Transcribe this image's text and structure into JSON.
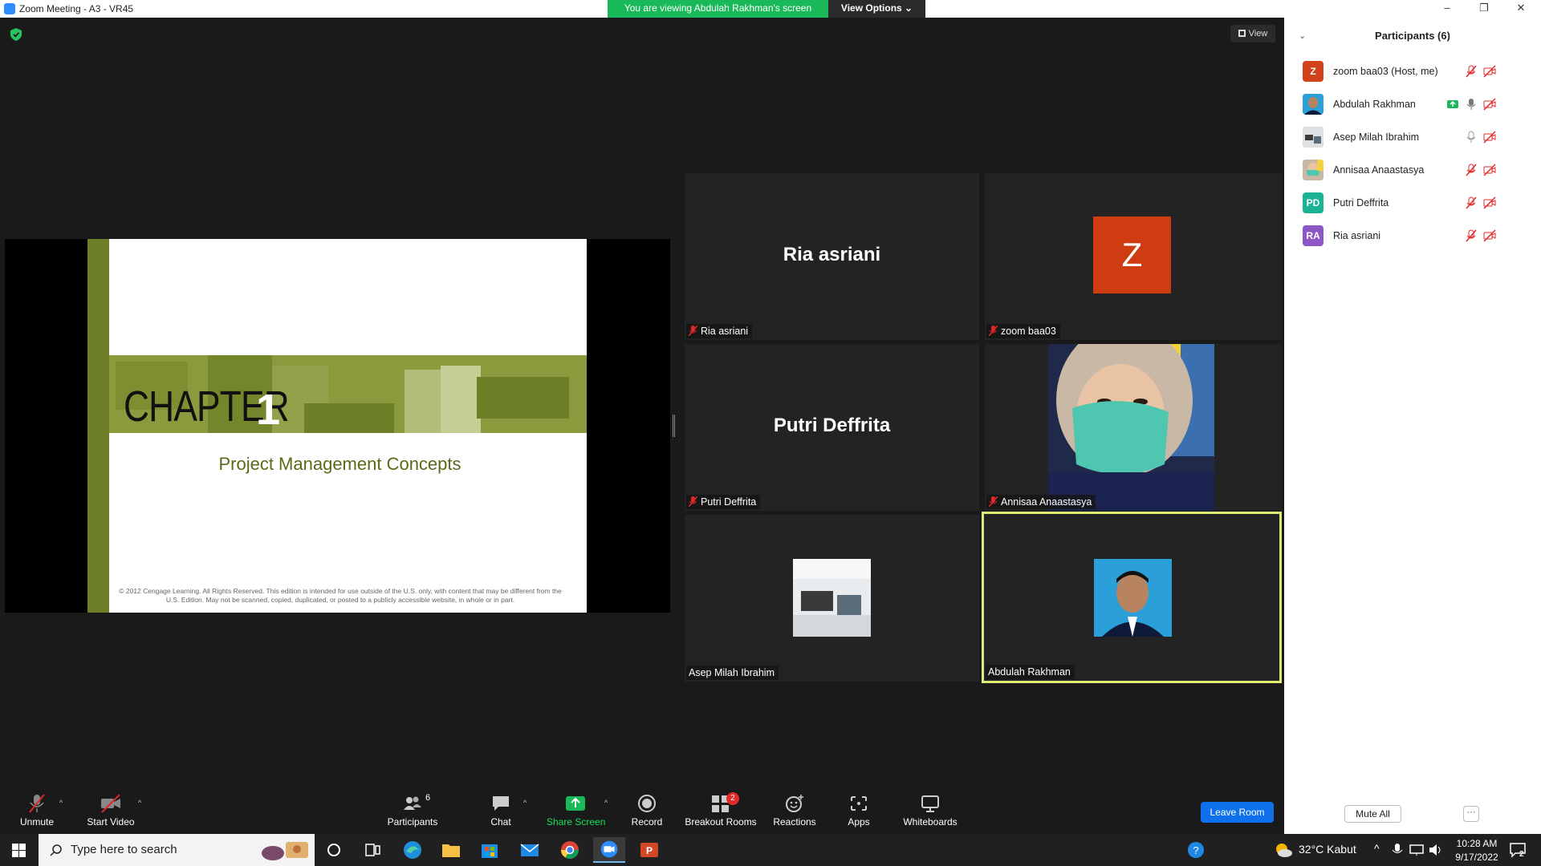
{
  "window": {
    "title": "Zoom Meeting - A3 - VR45",
    "minimize": "–",
    "restore": "❐",
    "close": "✕"
  },
  "banner": {
    "viewing": "You are viewing Abdulah Rakhman's screen",
    "view_options": "View Options ⌄"
  },
  "view_button": "View",
  "slide": {
    "chapter": "CHAPTER",
    "number": "1",
    "subtitle": "Project Management Concepts",
    "copyright": "© 2012 Cengage Learning. All Rights Reserved. This edition is intended for use outside of the U.S. only, with content that may be different from the U.S. Edition. May not be scanned, copied, duplicated, or posted to a publicly accessible website, in whole or in part."
  },
  "tiles": [
    {
      "label": "Ria asriani",
      "big": "Ria asriani",
      "muted": true
    },
    {
      "label": "zoom baa03",
      "big": "Z",
      "muted": true
    },
    {
      "label": "Putri Deffrita",
      "big": "Putri Deffrita",
      "muted": true
    },
    {
      "label": "Annisaa Anaastasya",
      "muted": true
    },
    {
      "label": "Asep Milah Ibrahim",
      "muted": false
    },
    {
      "label": "Abdulah Rakhman",
      "muted": false
    }
  ],
  "participants": {
    "title": "Participants (6)",
    "list": [
      {
        "initials": "Z",
        "name": "zoom baa03 (Host, me)",
        "color": "#d2431b"
      },
      {
        "initials": "",
        "name": "Abdulah Rakhman",
        "color": "#3a8fd6"
      },
      {
        "initials": "",
        "name": "Asep Milah Ibrahim",
        "color": "#8a8a8a"
      },
      {
        "initials": "",
        "name": "Annisaa Anaastasya",
        "color": "#7fa36b"
      },
      {
        "initials": "PD",
        "name": "Putri Deffrita",
        "color": "#1ab394"
      },
      {
        "initials": "RA",
        "name": "Ria asriani",
        "color": "#8d57c7"
      }
    ],
    "mute_all": "Mute All",
    "more": "···"
  },
  "toolbar": {
    "unmute": "Unmute",
    "start_video": "Start Video",
    "participants": "Participants",
    "participants_count": "6",
    "chat": "Chat",
    "share_screen": "Share Screen",
    "record": "Record",
    "breakout_rooms": "Breakout Rooms",
    "breakout_badge": "2",
    "reactions": "Reactions",
    "apps": "Apps",
    "whiteboards": "Whiteboards",
    "leave_room": "Leave Room"
  },
  "taskbar": {
    "search_placeholder": "Type here to search",
    "weather": "32°C  Kabut",
    "time": "10:28 AM",
    "date": "9/17/2022",
    "notif_count": "2"
  },
  "colors": {
    "accent": "#0e71eb",
    "share": "#19b95a",
    "active_speaker": "#e1ec75",
    "mute_red": "#e02828"
  }
}
